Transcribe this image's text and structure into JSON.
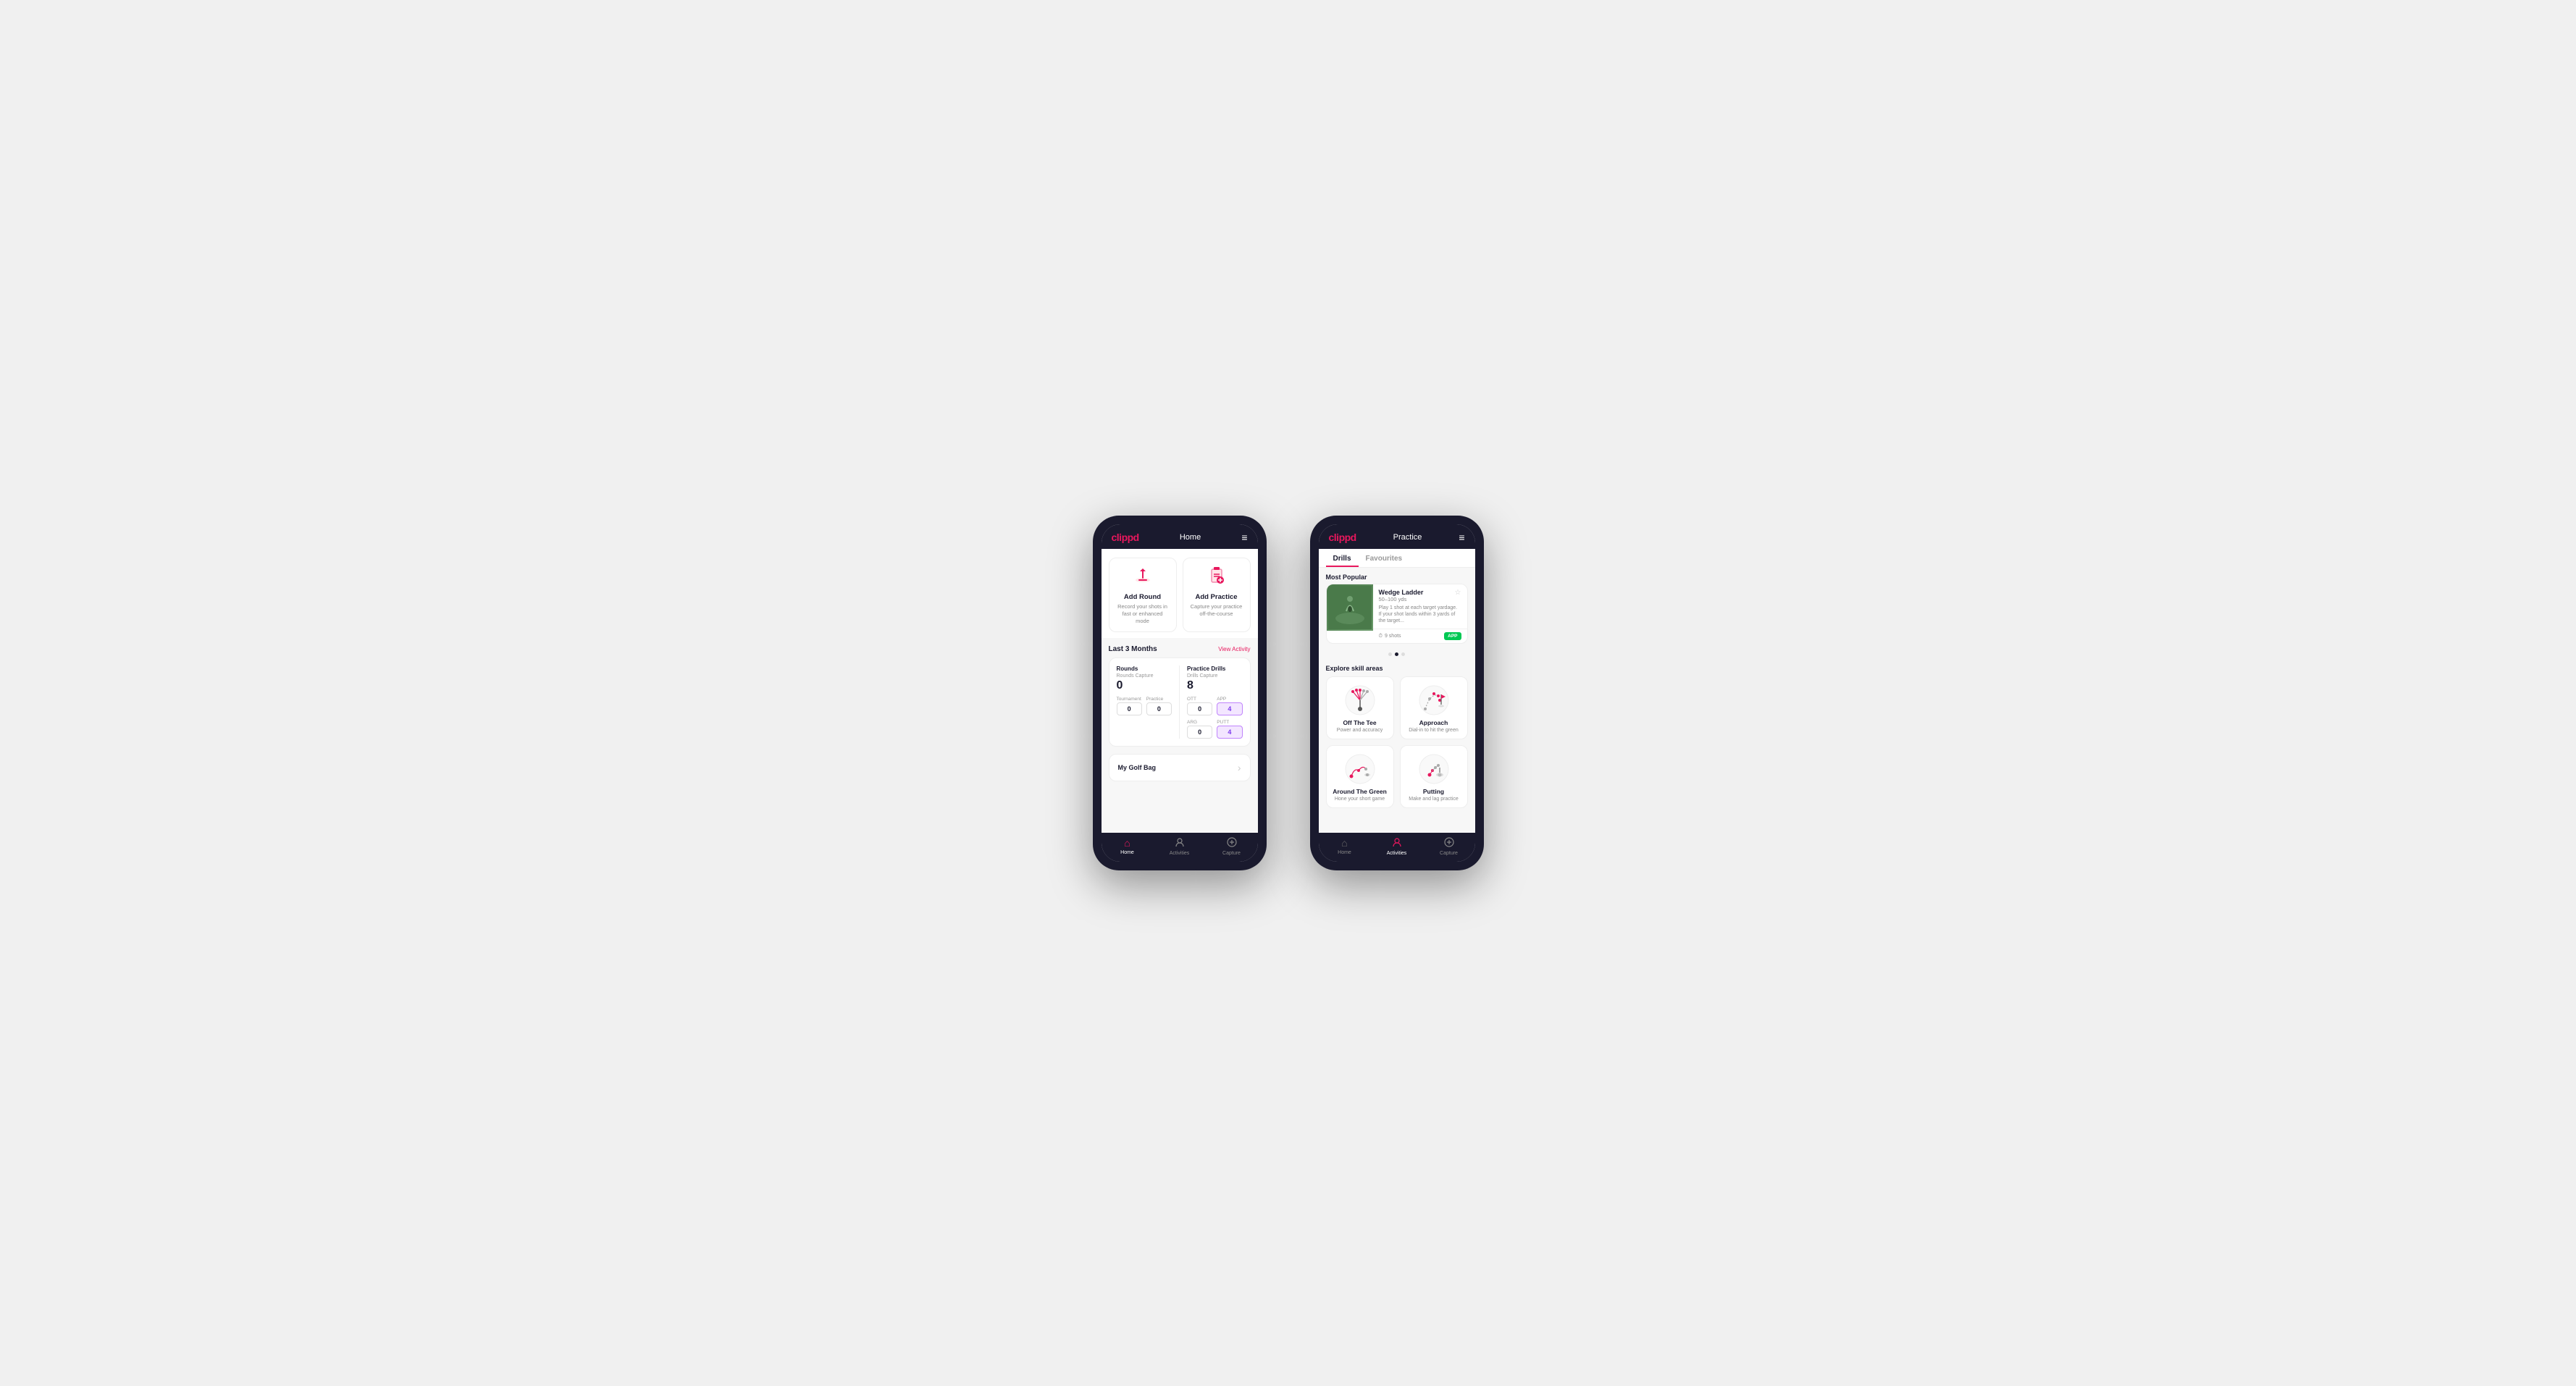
{
  "phone1": {
    "header": {
      "logo": "clippd",
      "title": "Home",
      "menu_icon": "≡"
    },
    "quick_actions": [
      {
        "id": "add-round",
        "icon": "🏌️",
        "title": "Add Round",
        "desc": "Record your shots in fast or enhanced mode"
      },
      {
        "id": "add-practice",
        "icon": "📋",
        "title": "Add Practice",
        "desc": "Capture your practice off-the-course"
      }
    ],
    "activity": {
      "section_title": "Last 3 Months",
      "view_link": "View Activity",
      "rounds": {
        "title": "Rounds",
        "capture_label": "Rounds Capture",
        "value": "0",
        "sub_items": [
          {
            "label": "Tournament",
            "value": "0"
          },
          {
            "label": "Practice",
            "value": "0"
          }
        ]
      },
      "practice_drills": {
        "title": "Practice Drills",
        "capture_label": "Drills Capture",
        "value": "8",
        "sub_items": [
          {
            "label": "OTT",
            "value": "0"
          },
          {
            "label": "APP",
            "value": "4",
            "highlight": true
          },
          {
            "label": "ARG",
            "value": "0"
          },
          {
            "label": "PUTT",
            "value": "4",
            "highlight": true
          }
        ]
      }
    },
    "golf_bag": {
      "title": "My Golf Bag",
      "chevron": "›"
    },
    "bottom_nav": [
      {
        "icon": "⌂",
        "label": "Home",
        "active": true
      },
      {
        "icon": "♻",
        "label": "Activities",
        "active": false
      },
      {
        "icon": "⊕",
        "label": "Capture",
        "active": false
      }
    ]
  },
  "phone2": {
    "header": {
      "logo": "clippd",
      "title": "Practice",
      "menu_icon": "≡"
    },
    "tabs": [
      {
        "label": "Drills",
        "active": true
      },
      {
        "label": "Favourites",
        "active": false
      }
    ],
    "most_popular": {
      "label": "Most Popular",
      "drill": {
        "name": "Wedge Ladder",
        "yardage": "50–100 yds",
        "desc": "Play 1 shot at each target yardage. If your shot lands within 3 yards of the target...",
        "shots": "9 shots",
        "badge": "APP"
      },
      "dots": [
        false,
        true,
        false
      ]
    },
    "explore": {
      "label": "Explore skill areas",
      "skills": [
        {
          "id": "off-the-tee",
          "name": "Off The Tee",
          "desc": "Power and accuracy",
          "icon_type": "tee"
        },
        {
          "id": "approach",
          "name": "Approach",
          "desc": "Dial-in to hit the green",
          "icon_type": "approach"
        },
        {
          "id": "around-the-green",
          "name": "Around The Green",
          "desc": "Hone your short game",
          "icon_type": "atg"
        },
        {
          "id": "putting",
          "name": "Putting",
          "desc": "Make and lag practice",
          "icon_type": "putting"
        }
      ]
    },
    "bottom_nav": [
      {
        "icon": "⌂",
        "label": "Home",
        "active": false
      },
      {
        "icon": "♻",
        "label": "Activities",
        "active": true
      },
      {
        "icon": "⊕",
        "label": "Capture",
        "active": false
      }
    ]
  }
}
